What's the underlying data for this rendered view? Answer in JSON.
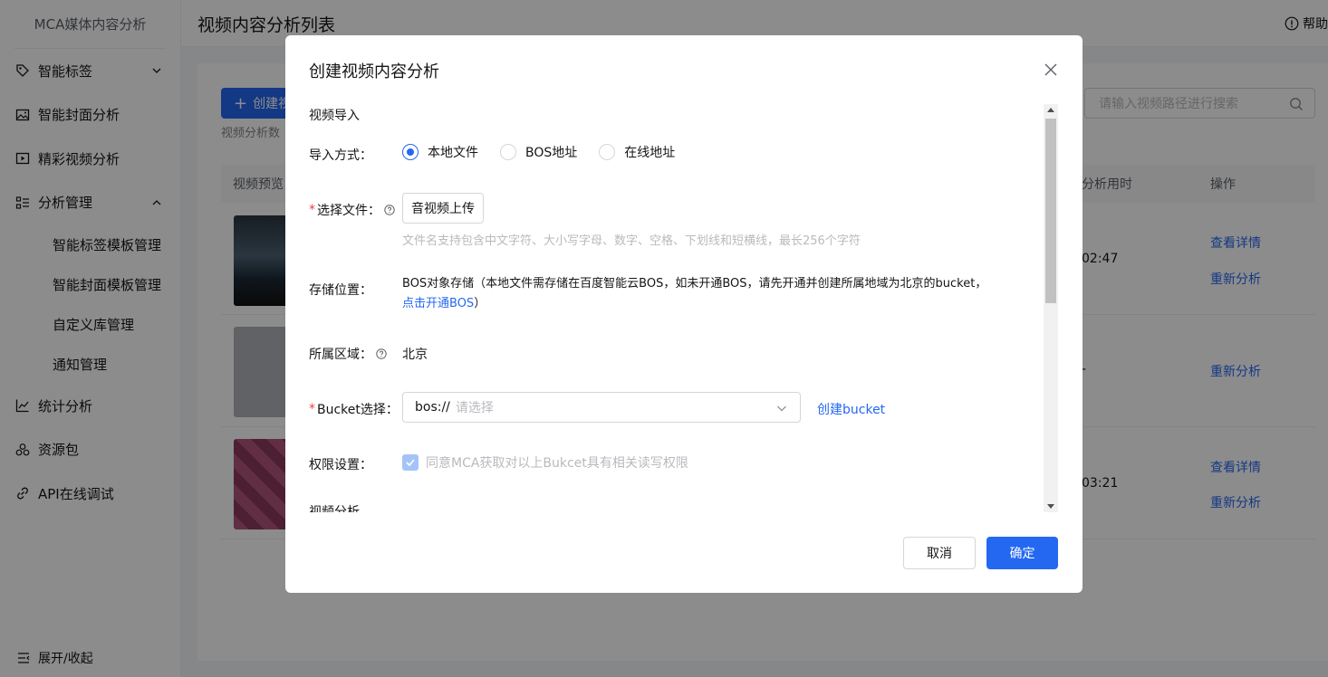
{
  "colors": {
    "accent": "#2468f2",
    "required": "#f33e3e",
    "mask": "rgba(0,0,0,0.45)"
  },
  "sidebar": {
    "title": "MCA媒体内容分析",
    "items": [
      {
        "label": "智能标签",
        "icon": "tag-icon",
        "expandable": true
      },
      {
        "label": "智能封面分析",
        "icon": "image-icon"
      },
      {
        "label": "精彩视频分析",
        "icon": "video-icon"
      },
      {
        "label": "分析管理",
        "icon": "manage-icon",
        "expandable": true,
        "expanded": true
      }
    ],
    "sub_items": [
      "智能标签模板管理",
      "智能封面模板管理",
      "自定义库管理",
      "通知管理"
    ],
    "items_after": [
      {
        "label": "统计分析",
        "icon": "chart-icon"
      },
      {
        "label": "资源包",
        "icon": "package-icon"
      },
      {
        "label": "API在线调试",
        "icon": "link-icon"
      }
    ],
    "footer": "展开/收起"
  },
  "header": {
    "title": "视频内容分析列表",
    "help": "帮助"
  },
  "main": {
    "create_button": "创建视",
    "sub_note": "视频分析数",
    "search_placeholder": "请输入视频路径进行搜索",
    "columns": {
      "preview": "视频预览",
      "duration": "分析用时",
      "ops": "操作"
    },
    "rows": [
      {
        "duration": "02:47",
        "actions": [
          "查看详情",
          "重新分析"
        ]
      },
      {
        "duration": "-",
        "actions": [
          "重新分析"
        ]
      },
      {
        "duration": "03:21",
        "actions": [
          "查看详情",
          "重新分析"
        ]
      }
    ]
  },
  "dialog": {
    "title": "创建视频内容分析",
    "section_import": "视频导入",
    "import_label": "导入方式：",
    "import_options": [
      "本地文件",
      "BOS地址",
      "在线地址"
    ],
    "import_selected": "本地文件",
    "file_label": "选择文件：",
    "upload_button": "音视频上传",
    "file_hint": "文件名支持包含中文字符、大小写字母、数字、空格、下划线和短横线，最长256个字符",
    "storage_label": "存储位置：",
    "storage_text": "BOS对象存储（本地文件需存储在百度智能云BOS，如未开通BOS，请先开通并创建所属地域为北京的bucket，",
    "storage_link": "点击开通BOS",
    "storage_tail": "）",
    "region_label": "所属区域：",
    "region_value": "北京",
    "bucket_label": "Bucket选择：",
    "bucket_prefix": "bos://",
    "bucket_placeholder": "请选择",
    "create_bucket": "创建bucket",
    "perm_label": "权限设置：",
    "perm_text": "同意MCA获取对以上Bukcet具有相关读写权限",
    "section_analysis": "视频分析",
    "cancel": "取消",
    "ok": "确定"
  }
}
